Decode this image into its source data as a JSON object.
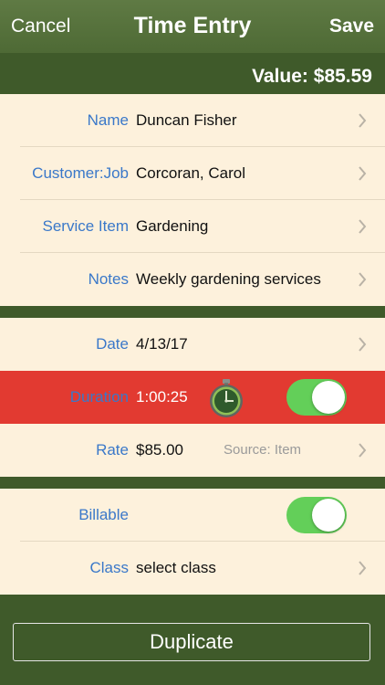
{
  "nav": {
    "cancel": "Cancel",
    "title": "Time Entry",
    "save": "Save"
  },
  "value_label": "Value: $85.59",
  "rows": {
    "name": {
      "label": "Name",
      "value": "Duncan Fisher"
    },
    "customer": {
      "label": "Customer:Job",
      "value": "Corcoran, Carol"
    },
    "service": {
      "label": "Service Item",
      "value": "Gardening"
    },
    "notes": {
      "label": "Notes",
      "value": "Weekly gardening services"
    },
    "date": {
      "label": "Date",
      "value": "4/13/17"
    },
    "duration": {
      "label": "Duration",
      "value": "1:00:25",
      "timer_on": true
    },
    "rate": {
      "label": "Rate",
      "value": "$85.00",
      "source": "Source: Item"
    },
    "billable": {
      "label": "Billable",
      "on": true
    },
    "class": {
      "label": "Class",
      "value": "select class"
    }
  },
  "duplicate_label": "Duplicate",
  "colors": {
    "nav_green": "#5f7a44",
    "dark_green": "#3f5a2a",
    "row_bg": "#fdf1dc",
    "label_blue": "#3a78c9",
    "highlight_red": "#e23a31",
    "toggle_green": "#63cf59"
  },
  "icons": {
    "chevron": "chevron-right-icon",
    "stopwatch": "stopwatch-icon"
  }
}
